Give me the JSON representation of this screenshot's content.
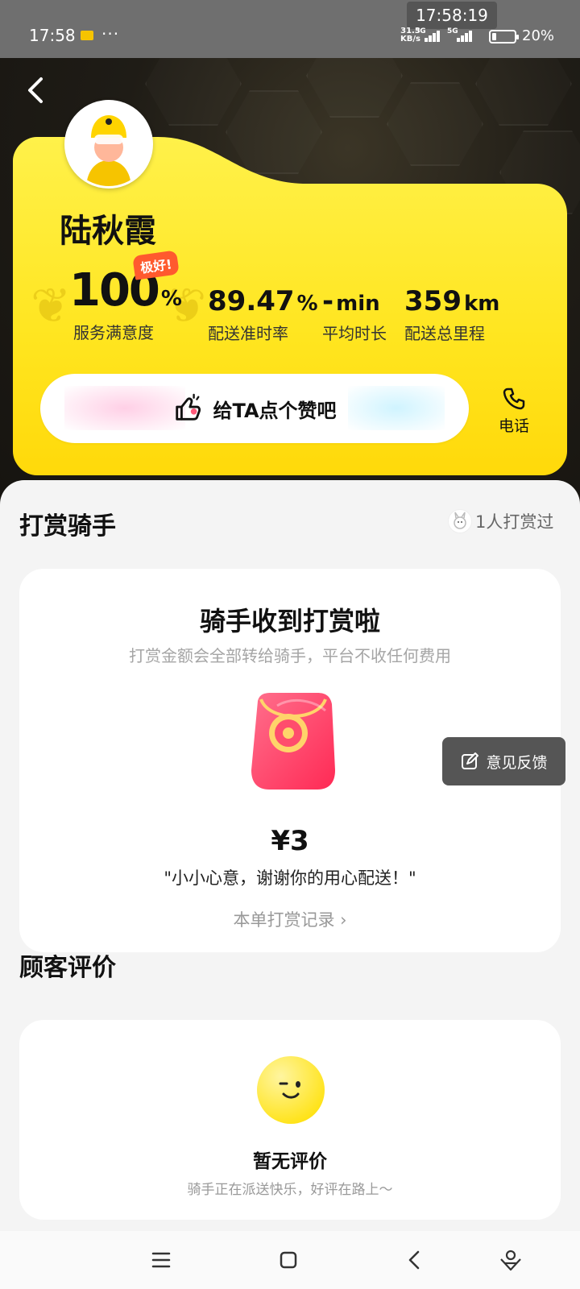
{
  "status_bar": {
    "time": "17:58",
    "dots": "···",
    "clock_overlay": "17:58:19",
    "net_speed_value": "31.3",
    "net_speed_unit": "KB/s",
    "signal_1": "5G",
    "signal_2": "5G",
    "battery_percent": "20%",
    "battery_level": 0.2
  },
  "rider": {
    "name": "陆秋霞",
    "badge": "极好!",
    "stats": [
      {
        "value": "100",
        "unit": "%",
        "label": "服务满意度"
      },
      {
        "value": "89.47",
        "unit": "%",
        "label": "配送准时率"
      },
      {
        "value": "-",
        "unit": "min",
        "label": "平均时长"
      },
      {
        "value": "359",
        "unit": "km",
        "label": "配送总里程"
      }
    ],
    "like_label": "给TA点个赞吧",
    "phone_label": "电话"
  },
  "tip_section": {
    "title": "打赏骑手",
    "count_text": "1人打赏过",
    "card_title": "骑手收到打赏啦",
    "card_subtitle": "打赏金额会全部转给骑手，平台不收任何费用",
    "amount": "¥3",
    "message": "\"小小心意，谢谢你的用心配送！\"",
    "record_link": "本单打赏记录 ›"
  },
  "feedback_label": "意见反馈",
  "review_section": {
    "title": "顾客评价",
    "empty_title": "暂无评价",
    "empty_subtitle": "骑手正在派送快乐，好评在路上～"
  },
  "colors": {
    "accent_yellow": "#ffe51f",
    "badge_orange": "#ff5a2e",
    "envelope_red": "#ff3d68"
  }
}
